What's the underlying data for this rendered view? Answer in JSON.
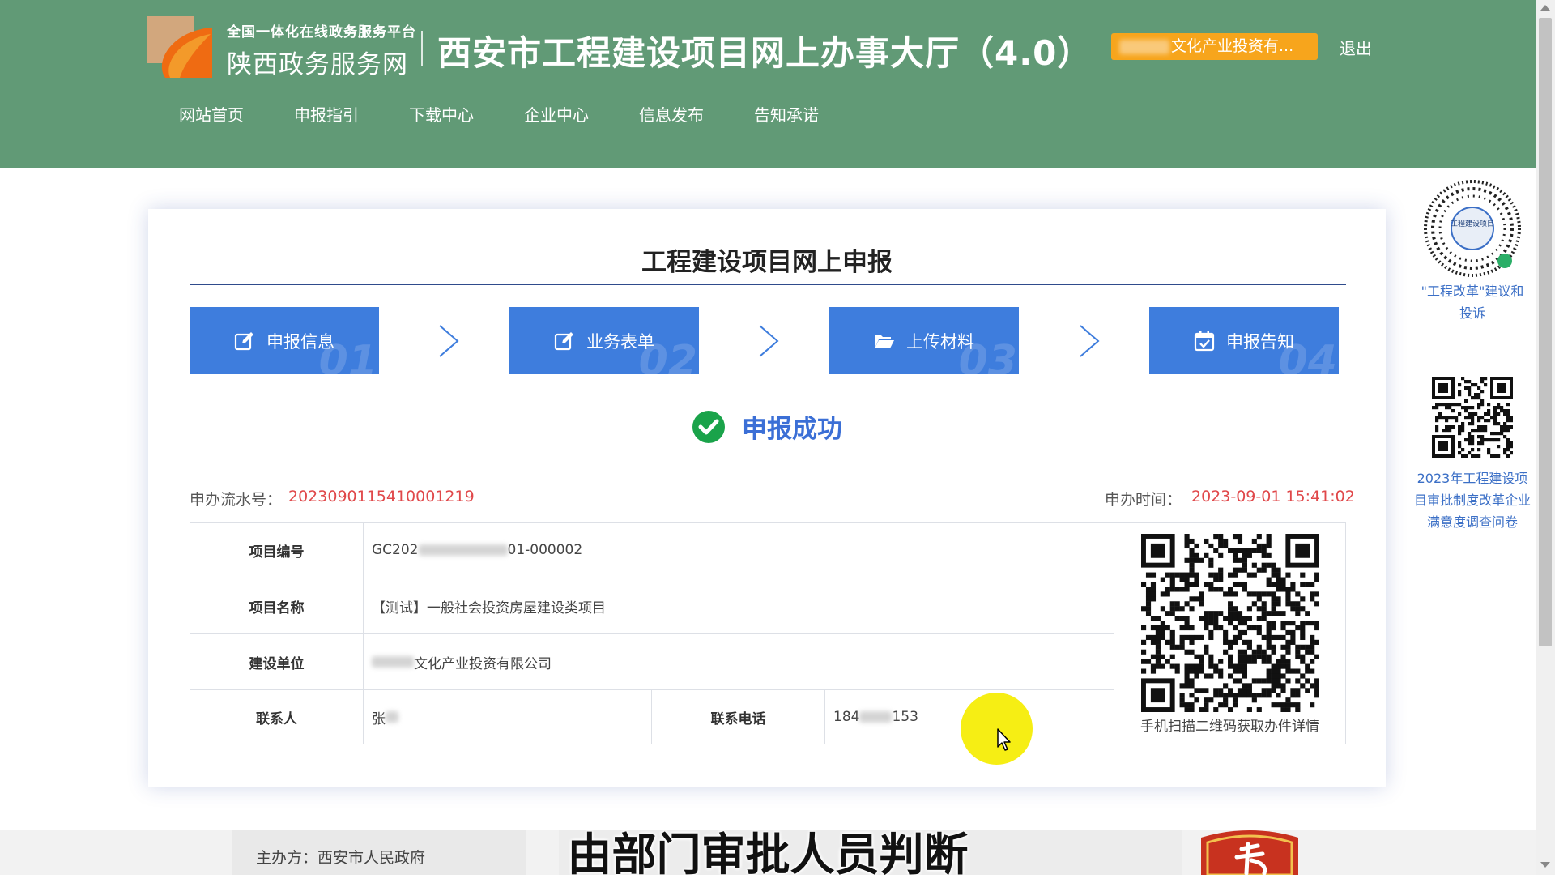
{
  "header": {
    "logo_small": "全国一体化在线政务服务平台",
    "logo_big": "陕西政务服务网",
    "site_title": "西安市工程建设项目网上办事大厅（4.0）",
    "user_badge_text": "文化产业投资有...",
    "logout": "退出",
    "bg_color": "#619a76",
    "badge_color": "#f7a51c"
  },
  "nav": {
    "items": [
      {
        "label": "网站首页"
      },
      {
        "label": "申报指引"
      },
      {
        "label": "下载中心"
      },
      {
        "label": "企业中心"
      },
      {
        "label": "信息发布"
      },
      {
        "label": "告知承诺"
      }
    ]
  },
  "panel": {
    "title": "工程建设项目网上申报",
    "steps": [
      {
        "label": "申报信息",
        "num": "01",
        "icon": "edit-icon"
      },
      {
        "label": "业务表单",
        "num": "02",
        "icon": "edit-icon"
      },
      {
        "label": "上传材料",
        "num": "03",
        "icon": "folder-open-icon"
      },
      {
        "label": "申报告知",
        "num": "04",
        "icon": "calendar-check-icon"
      }
    ],
    "step_color": "#3e7ddd",
    "success_text": "申报成功",
    "serial_label": "申办流水号：",
    "serial_value": "2023090115410001219",
    "time_label": "申办时间：",
    "time_value": "2023-09-01 15:41:02"
  },
  "table": {
    "project_code_label": "项目编号",
    "project_code_prefix": "GC202",
    "project_code_suffix": "01-000002",
    "project_name_label": "项目名称",
    "project_name_value": "【测试】一般社会投资房屋建设类项目",
    "builder_label": "建设单位",
    "builder_value": "文化产业投资有限公司",
    "contact_label": "联系人",
    "contact_value": "张",
    "phone_label": "联系电话",
    "phone_prefix": "184",
    "phone_suffix": "153",
    "qr_caption": "手机扫描二维码获取办件详情"
  },
  "sidebar": {
    "qr1_inner_text": "工程建设项目",
    "qr1_caption": "\"工程改革\"建议和投诉",
    "qr2_caption": "2023年工程建设项目审批制度改革企业满意度调查问卷"
  },
  "footer": {
    "host_text": "主办方：西安市人民政府"
  },
  "subtitle": "由部门审批人员判断"
}
